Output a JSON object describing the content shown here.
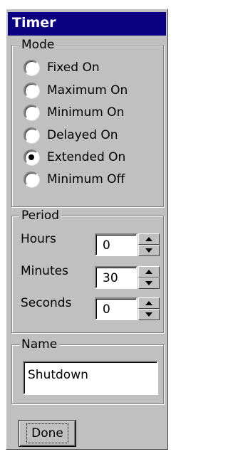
{
  "window": {
    "title": "Timer"
  },
  "mode": {
    "legend": "Mode",
    "options": [
      {
        "label": "Fixed On",
        "checked": false
      },
      {
        "label": "Maximum On",
        "checked": false
      },
      {
        "label": "Minimum On",
        "checked": false
      },
      {
        "label": "Delayed On",
        "checked": false
      },
      {
        "label": "Extended On",
        "checked": true
      },
      {
        "label": "Minimum Off",
        "checked": false
      }
    ]
  },
  "period": {
    "legend": "Period",
    "hours": {
      "label": "Hours",
      "value": "0"
    },
    "minutes": {
      "label": "Minutes",
      "value": "30"
    },
    "seconds": {
      "label": "Seconds",
      "value": "0"
    }
  },
  "name": {
    "legend": "Name",
    "value": "Shutdown"
  },
  "done_label": "Done"
}
